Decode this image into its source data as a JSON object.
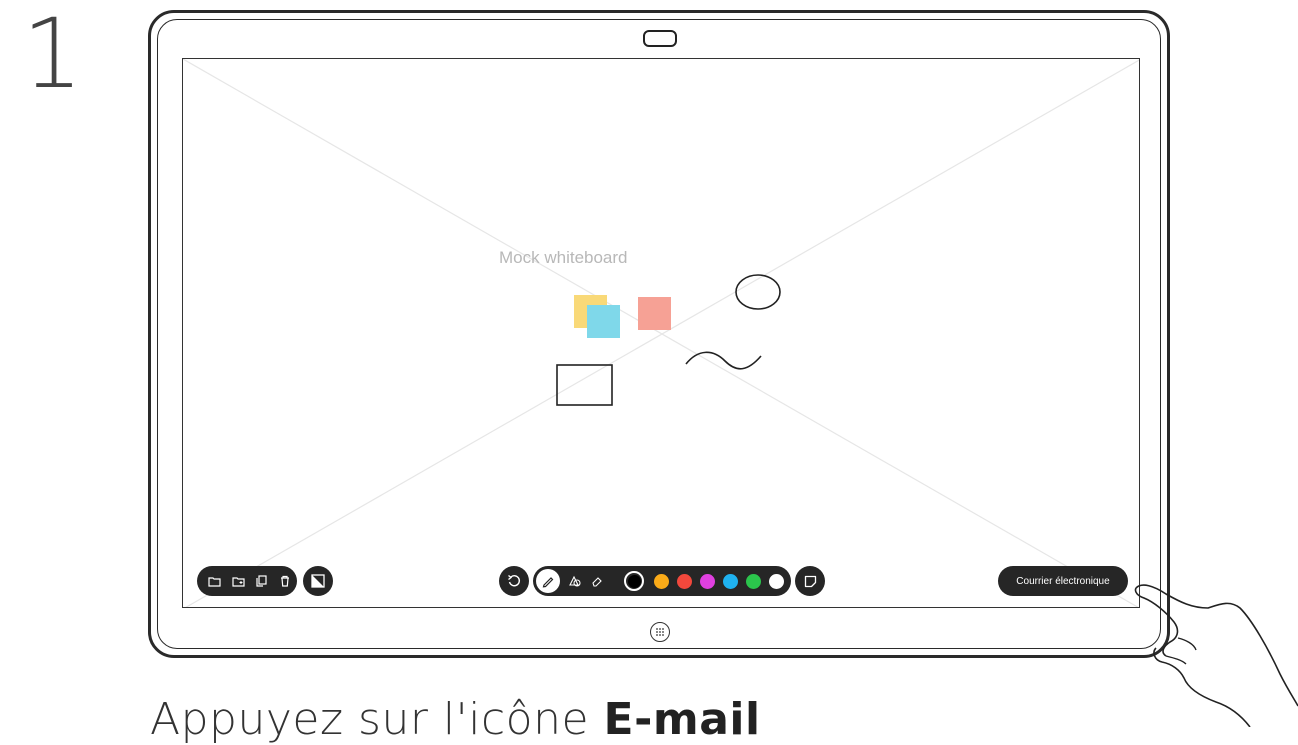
{
  "step": {
    "number": "1"
  },
  "whiteboard": {
    "label": "Mock whiteboard",
    "sticky_colors": [
      "#f9d978",
      "#7fd8ea",
      "#f6a195"
    ]
  },
  "toolbar": {
    "left_icons": [
      "folder-icon",
      "new-folder-icon",
      "copy-icon",
      "delete-icon"
    ],
    "background_toggle_icon": "contrast-icon",
    "undo_icon": "undo-icon",
    "tools": [
      "pen-icon",
      "shape-icon",
      "eraser-icon"
    ],
    "colors": [
      {
        "name": "black",
        "hex": "#000000",
        "selected": true
      },
      {
        "name": "yellow",
        "hex": "#fbab18"
      },
      {
        "name": "red",
        "hex": "#f2483c"
      },
      {
        "name": "magenta",
        "hex": "#e040e0"
      },
      {
        "name": "blue",
        "hex": "#1fb2f0"
      },
      {
        "name": "green",
        "hex": "#2bc54c"
      },
      {
        "name": "white",
        "hex": "#ffffff"
      }
    ],
    "sticky_note_icon": "sticky-note-icon"
  },
  "email_button": {
    "label": "Courrier électronique"
  },
  "instruction": {
    "prefix": "Appuyez sur l'icône ",
    "emphasis": "E-mail"
  }
}
